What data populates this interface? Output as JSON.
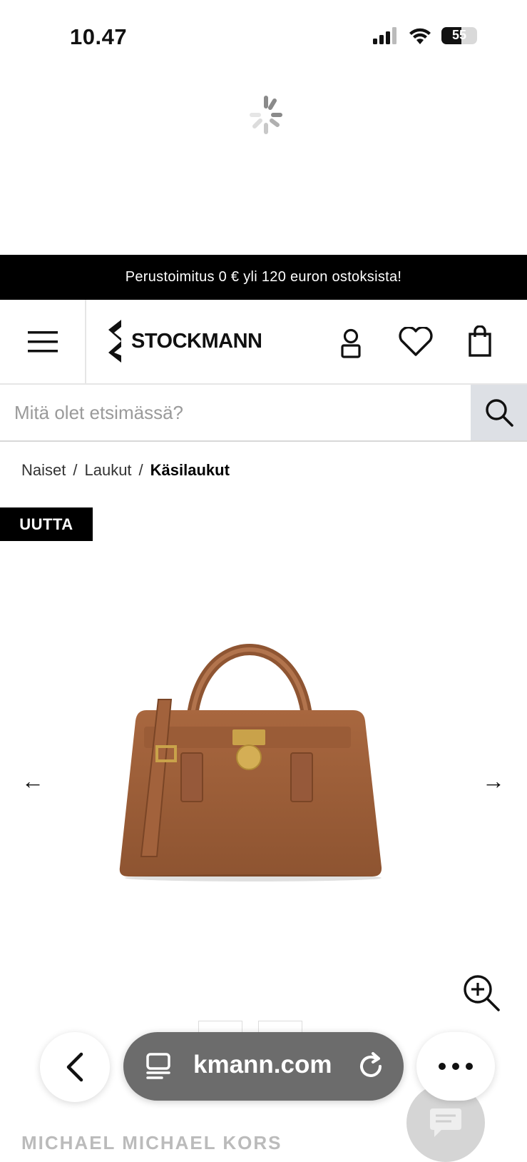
{
  "status": {
    "time": "10.47",
    "battery": "55",
    "battery_level": 0.55
  },
  "promo": {
    "text": "Perustoimitus 0 € yli 120 euron ostoksista!"
  },
  "header": {
    "logo_text": "STOCKMANN"
  },
  "search": {
    "placeholder": "Mitä olet etsimässä?"
  },
  "breadcrumb": {
    "items": [
      "Naiset",
      "Laukut"
    ],
    "separator": "/",
    "current": "Käsilaukut"
  },
  "product": {
    "badge": "UUTTA",
    "prev_arrow": "←",
    "next_arrow": "→",
    "title_partial": "MICHAEL MICHAEL KORS"
  },
  "browser": {
    "url": "kmann.com"
  },
  "colors": {
    "promo_bg": "#000000",
    "search_button_bg": "#dde0e5",
    "bag_brown": "#a0603a",
    "hardware_gold": "#c9a24a",
    "url_pill_bg": "#6c6c6c"
  },
  "icons": [
    "signal-icon",
    "wifi-icon",
    "battery-icon",
    "loading-spinner",
    "menu-icon",
    "stockmann-logo-icon",
    "account-icon",
    "heart-icon",
    "shopping-bag-icon",
    "search-icon",
    "arrow-left-icon",
    "arrow-right-icon",
    "zoom-in-icon",
    "back-icon",
    "tabs-icon",
    "reload-icon",
    "more-icon",
    "chat-icon"
  ]
}
